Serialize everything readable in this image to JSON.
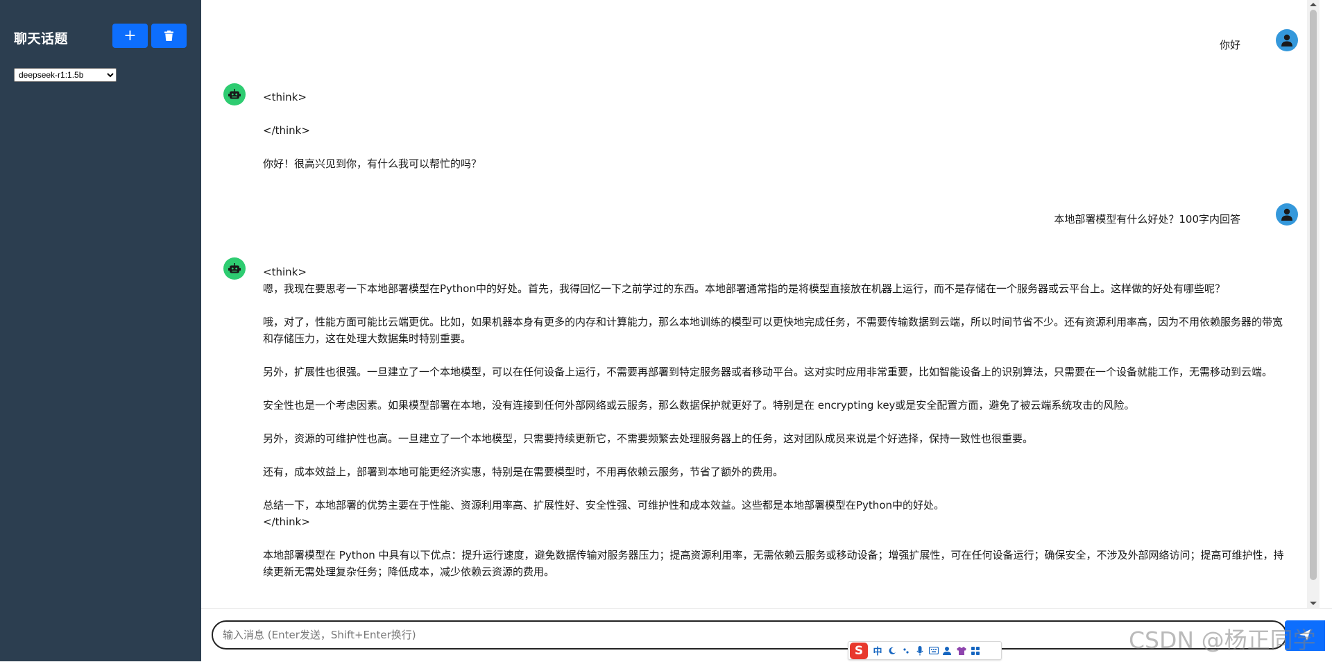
{
  "sidebar": {
    "title": "聊天话题",
    "add_button": "+",
    "model_select": {
      "value": "deepseek-r1:1.5b",
      "options": [
        "deepseek-r1:1.5b"
      ]
    }
  },
  "messages": [
    {
      "role": "user",
      "text": "你好"
    },
    {
      "role": "assistant",
      "lines": [
        "<think>",
        "",
        "</think>",
        "",
        "你好！很高兴见到你，有什么我可以帮忙的吗？"
      ]
    },
    {
      "role": "user",
      "text": "本地部署模型有什么好处？100字内回答"
    },
    {
      "role": "assistant",
      "lines": [
        "<think>",
        "嗯，我现在要思考一下本地部署模型在Python中的好处。首先，我得回忆一下之前学过的东西。本地部署通常指的是将模型直接放在机器上运行，而不是存储在一个服务器或云平台上。这样做的好处有哪些呢？",
        "",
        "哦，对了，性能方面可能比云端更优。比如，如果机器本身有更多的内存和计算能力，那么本地训练的模型可以更快地完成任务，不需要传输数据到云端，所以时间节省不少。还有资源利用率高，因为不用依赖服务器的带宽和存储压力，这在处理大数据集时特别重要。",
        "",
        "另外，扩展性也很强。一旦建立了一个本地模型，可以在任何设备上运行，不需要再部署到特定服务器或者移动平台。这对实时应用非常重要，比如智能设备上的识别算法，只需要在一个设备就能工作，无需移动到云端。",
        "",
        "安全性也是一个考虑因素。如果模型部署在本地，没有连接到任何外部网络或云服务，那么数据保护就更好了。特别是在 encrypting key或是安全配置方面，避免了被云端系统攻击的风险。",
        "",
        "另外，资源的可维护性也高。一旦建立了一个本地模型，只需要持续更新它，不需要频繁去处理服务器上的任务，这对团队成员来说是个好选择，保持一致性也很重要。",
        "",
        "还有，成本效益上，部署到本地可能更经济实惠，特别是在需要模型时，不用再依赖云服务，节省了额外的费用。",
        "",
        "总结一下，本地部署的优势主要在于性能、资源利用率高、扩展性好、安全性强、可维护性和成本效益。这些都是本地部署模型在Python中的好处。",
        "</think>",
        "",
        "本地部署模型在 Python 中具有以下优点：提升运行速度，避免数据传输对服务器压力；提高资源利用率，无需依赖云服务或移动设备；增强扩展性，可在任何设备运行；确保安全，不涉及外部网络访问；提高可维护性，持续更新无需处理复杂任务；降低成本，减少依赖云资源的费用。"
      ]
    }
  ],
  "input": {
    "placeholder": "输入消息 (Enter发送，Shift+Enter换行)",
    "value": ""
  },
  "ime": {
    "logo": "S",
    "mode": "中"
  },
  "watermark": "CSDN @杨正同学",
  "colors": {
    "sidebar_bg": "#2c3e50",
    "button": "#0d6efd",
    "user_avatar": "#3498db",
    "bot_avatar": "#2ecc71"
  }
}
